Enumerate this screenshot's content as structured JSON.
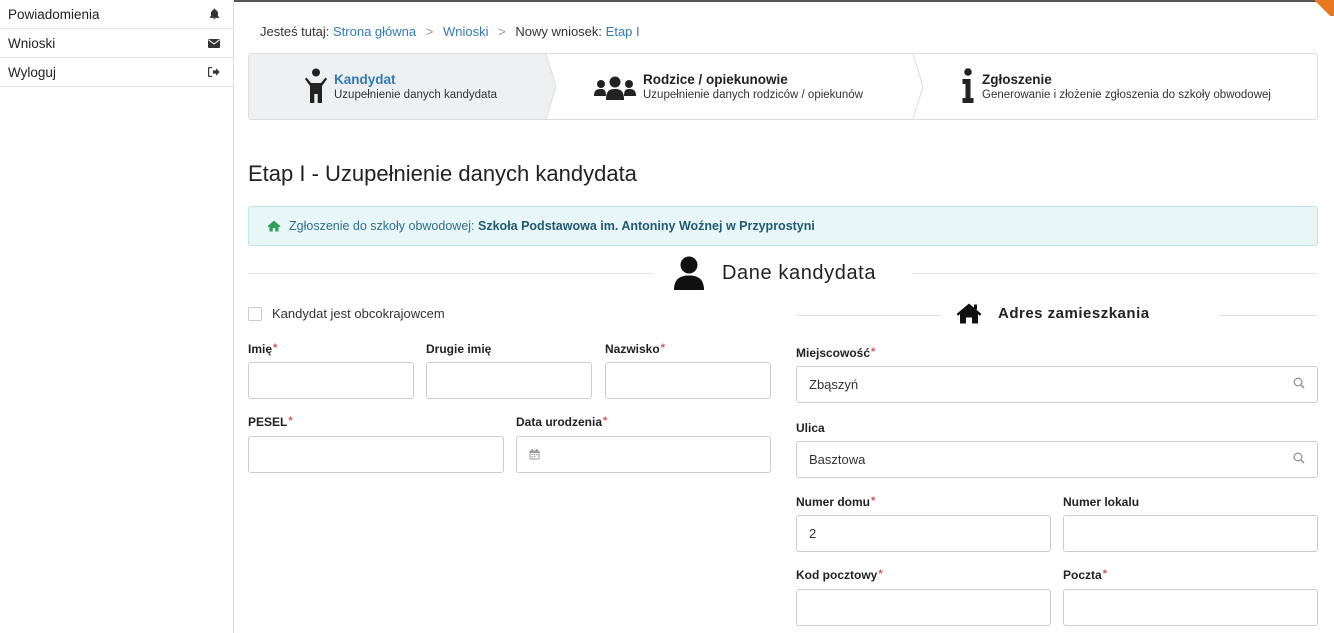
{
  "sidebar": {
    "items": [
      {
        "label": "Powiadomienia",
        "icon": "bell-icon"
      },
      {
        "label": "Wnioski",
        "icon": "envelope-icon"
      },
      {
        "label": "Wyloguj",
        "icon": "sign-out-icon"
      }
    ]
  },
  "breadcrumb": {
    "prefix": "Jesteś tutaj:",
    "home": "Strona główna",
    "applications": "Wnioski",
    "new_label": "Nowy wniosek:",
    "current": "Etap I"
  },
  "steps": [
    {
      "title": "Kandydat",
      "subtitle": "Uzupełnienie danych kandydata",
      "icon": "child-icon",
      "active": true
    },
    {
      "title": "Rodzice / opiekunowie",
      "subtitle": "Uzupełnienie danych rodziców / opiekunów",
      "icon": "users-icon",
      "active": false
    },
    {
      "title": "Zgłoszenie",
      "subtitle": "Generowanie i złożenie zgłoszenia do szkoły obwodowej",
      "icon": "info-icon",
      "active": false
    }
  ],
  "page_title": "Etap I - Uzupełnienie danych kandydata",
  "alert": {
    "prefix": "Zgłoszenie do szkoły obwodowej:",
    "school": "Szkoła Podstawowa im. Antoniny Woźnej w Przyprostyni",
    "icon": "home-icon"
  },
  "candidate_section": {
    "title": "Dane kandydata",
    "icon": "user-icon"
  },
  "foreigner_checkbox": {
    "label": "Kandydat jest obcokrajowcem",
    "checked": false
  },
  "form": {
    "first_name": {
      "label": "Imię",
      "value": ""
    },
    "second_name": {
      "label": "Drugie imię",
      "value": ""
    },
    "last_name": {
      "label": "Nazwisko",
      "value": ""
    },
    "pesel": {
      "label": "PESEL",
      "value": ""
    },
    "birth_date": {
      "label": "Data urodzenia",
      "value": "",
      "icon": "calendar-icon"
    }
  },
  "address_section": {
    "title": "Adres zamieszkania",
    "icon": "home-icon"
  },
  "address": {
    "city": {
      "label": "Miejscowość",
      "value": "Zbąszyń"
    },
    "street": {
      "label": "Ulica",
      "value": "Basztowa"
    },
    "house_no": {
      "label": "Numer domu",
      "value": "2"
    },
    "flat_no": {
      "label": "Numer lokalu",
      "value": ""
    },
    "postal_code": {
      "label": "Kod pocztowy",
      "value": ""
    },
    "post_office": {
      "label": "Poczta",
      "value": ""
    }
  },
  "required_marker": "*",
  "colors": {
    "link": "#337ab7",
    "required": "#d9534f",
    "alert_bg": "#e8f6f8",
    "active_step_bg": "#eeeff1",
    "corner_accent": "#e87722"
  }
}
